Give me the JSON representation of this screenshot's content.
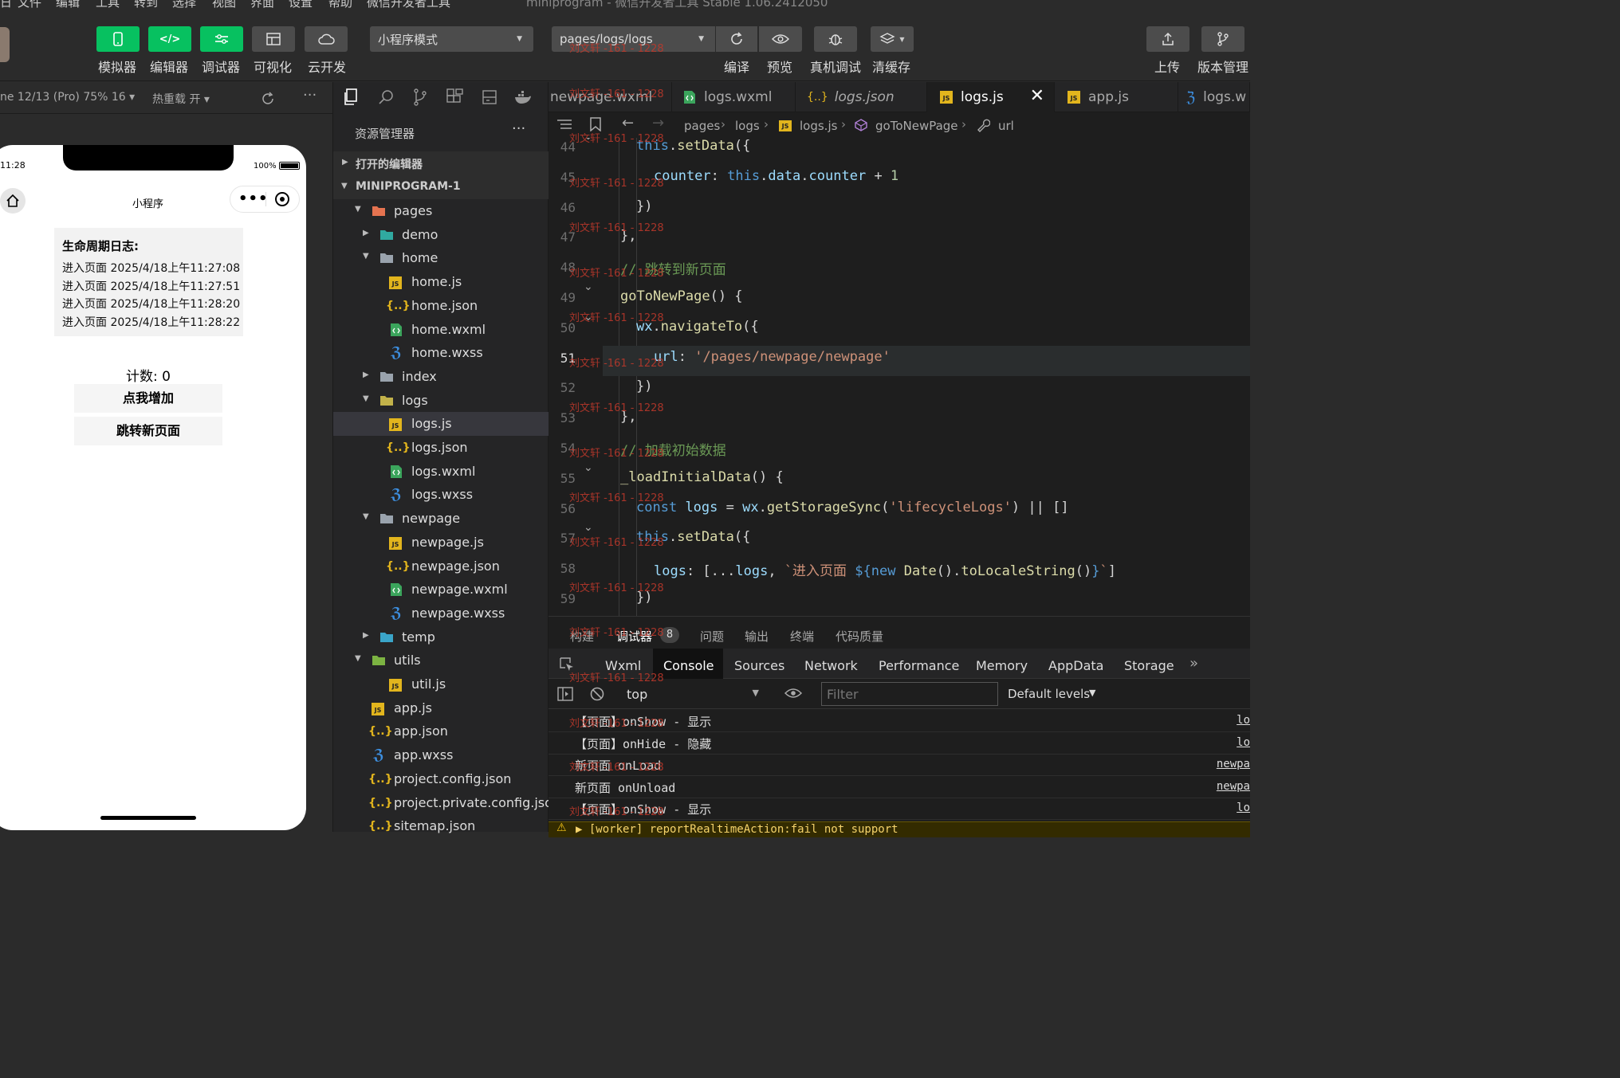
{
  "menubar": {
    "items": [
      "文件",
      "编辑",
      "工具",
      "转到",
      "选择",
      "视图",
      "界面",
      "设置",
      "帮助",
      "微信开发者工具"
    ],
    "title": "miniprogram - 微信开发者工具 Stable 1.06.2412050"
  },
  "toolbar": {
    "buttons": [
      {
        "label": "模拟器",
        "icon": "phone-icon"
      },
      {
        "label": "编辑器",
        "icon": "code-icon"
      },
      {
        "label": "调试器",
        "icon": "debug-icon"
      },
      {
        "label": "可视化",
        "icon": "layout-icon"
      },
      {
        "label": "云开发",
        "icon": "cloud-icon"
      }
    ],
    "mode": "小程序模式",
    "page_path": "pages/logs/logs",
    "actions": [
      "编译",
      "预览",
      "真机调试",
      "清缓存"
    ],
    "right_actions": [
      "上传",
      "版本管理"
    ]
  },
  "simbar": {
    "device": "ne 12/13 (Pro) 75% 16 ▾",
    "hot_reload": "热重载 开 ▾"
  },
  "phone": {
    "time": "11:28",
    "battery": "100%",
    "title": "小程序",
    "logs_title": "生命周期日志:",
    "logs": [
      "进入页面 2025/4/18上午11:27:08",
      "进入页面 2025/4/18上午11:27:51",
      "进入页面 2025/4/18上午11:28:20",
      "进入页面 2025/4/18上午11:28:22"
    ],
    "counter": "计数: 0",
    "btn_add": "点我增加",
    "btn_nav": "跳转新页面"
  },
  "explorer": {
    "title": "资源管理器",
    "open_editors": "打开的编辑器",
    "root": "MINIPROGRAM-1",
    "tree": [
      {
        "name": "pages",
        "type": "folder-pages",
        "depth": 1,
        "open": true
      },
      {
        "name": "demo",
        "type": "folder-demo",
        "depth": 2,
        "open": false
      },
      {
        "name": "home",
        "type": "folder",
        "depth": 2,
        "open": true
      },
      {
        "name": "home.js",
        "type": "js",
        "depth": 3
      },
      {
        "name": "home.json",
        "type": "json",
        "depth": 3
      },
      {
        "name": "home.wxml",
        "type": "wxml",
        "depth": 3
      },
      {
        "name": "home.wxss",
        "type": "wxss",
        "depth": 3
      },
      {
        "name": "index",
        "type": "folder",
        "depth": 2,
        "open": false
      },
      {
        "name": "logs",
        "type": "folder-logs",
        "depth": 2,
        "open": true
      },
      {
        "name": "logs.js",
        "type": "js",
        "depth": 3,
        "selected": true
      },
      {
        "name": "logs.json",
        "type": "json",
        "depth": 3
      },
      {
        "name": "logs.wxml",
        "type": "wxml",
        "depth": 3
      },
      {
        "name": "logs.wxss",
        "type": "wxss",
        "depth": 3
      },
      {
        "name": "newpage",
        "type": "folder",
        "depth": 2,
        "open": true
      },
      {
        "name": "newpage.js",
        "type": "js",
        "depth": 3
      },
      {
        "name": "newpage.json",
        "type": "json",
        "depth": 3
      },
      {
        "name": "newpage.wxml",
        "type": "wxml",
        "depth": 3
      },
      {
        "name": "newpage.wxss",
        "type": "wxss",
        "depth": 3
      },
      {
        "name": "temp",
        "type": "folder-temp",
        "depth": 2,
        "open": false
      },
      {
        "name": "utils",
        "type": "folder-utils",
        "depth": 1,
        "open": true
      },
      {
        "name": "util.js",
        "type": "js",
        "depth": 3
      },
      {
        "name": "app.js",
        "type": "js",
        "depth": 2
      },
      {
        "name": "app.json",
        "type": "json",
        "depth": 2
      },
      {
        "name": "app.wxss",
        "type": "wxss",
        "depth": 2
      },
      {
        "name": "project.config.json",
        "type": "json",
        "depth": 2
      },
      {
        "name": "project.private.config.json",
        "type": "json",
        "depth": 2
      },
      {
        "name": "sitemap.json",
        "type": "json",
        "depth": 2
      }
    ]
  },
  "tabs": [
    {
      "name": "newpage.wxml",
      "type": "none"
    },
    {
      "name": "logs.wxml",
      "type": "wxml"
    },
    {
      "name": "logs.json",
      "type": "json"
    },
    {
      "name": "logs.js",
      "type": "js",
      "active": true
    },
    {
      "name": "app.js",
      "type": "js"
    },
    {
      "name": "logs.w",
      "type": "wxss"
    }
  ],
  "breadcrumb": [
    "pages",
    "logs",
    "logs.js",
    "goToNewPage",
    "url"
  ],
  "code_lines": [
    {
      "n": "44",
      "html": "<span class='kw'>this</span>.<span class='fn'>setData</span>({"
    },
    {
      "n": "45",
      "html": "<span class='prop'>counter</span>: <span class='kw'>this</span>.<span class='prop'>data</span>.<span class='prop'>counter</span> + <span class='num'>1</span>"
    },
    {
      "n": "46",
      "html": "})"
    },
    {
      "n": "47",
      "html": "},"
    },
    {
      "n": "48",
      "html": "<span class='cm'>// 跳转到新页面</span>"
    },
    {
      "n": "49",
      "html": "<span class='fn'>goToNewPage</span>() {"
    },
    {
      "n": "50",
      "html": "<span class='prop'>wx</span>.<span class='fn'>navigateTo</span>({"
    },
    {
      "n": "51",
      "html": "<span class='prop'>url</span>: <span class='str'>'/pages/newpage/newpage'</span>"
    },
    {
      "n": "52",
      "html": "})"
    },
    {
      "n": "53",
      "html": "},"
    },
    {
      "n": "54",
      "html": "<span class='cm'>// 加载初始数据</span>"
    },
    {
      "n": "55",
      "html": "<span class='fn'>_loadInitialData</span>() {"
    },
    {
      "n": "56",
      "html": "<span class='kw'>const</span> <span class='prop'>logs</span> = <span class='prop'>wx</span>.<span class='fn'>getStorageSync</span>(<span class='str'>'lifecycleLogs'</span>) || []"
    },
    {
      "n": "57",
      "html": "<span class='kw'>this</span>.<span class='fn'>setData</span>({"
    },
    {
      "n": "58",
      "html": "<span class='prop'>logs</span>: [...<span class='prop'>logs</span>, <span class='str'>`进入页面 </span><span class='kw'>${new</span> <span class='fn'>Date</span>().<span class='fn'>toLocaleString</span>()<span class='kw'>}</span><span class='str'>`</span>]"
    },
    {
      "n": "59",
      "html": "})"
    }
  ],
  "watermark": "刘文轩 -161 - 1228",
  "panel": {
    "tabs": [
      "构建",
      "调试器",
      "问题",
      "输出",
      "终端",
      "代码质量"
    ],
    "debugger_badge": "8",
    "devtabs": [
      "Wxml",
      "Console",
      "Sources",
      "Network",
      "Performance",
      "Memory",
      "AppData",
      "Storage"
    ],
    "context": "top",
    "filter_placeholder": "Filter",
    "levels": "Default levels",
    "console_rows": [
      {
        "text": "【页面】onShow - 显示",
        "src": "lo"
      },
      {
        "text": "【页面】onHide - 隐藏",
        "src": "lo"
      },
      {
        "text": "新页面 onLoad",
        "src": "newpa"
      },
      {
        "text": "新页面 onUnload",
        "src": "newpa"
      },
      {
        "text": "【页面】onShow - 显示",
        "src": "lo"
      }
    ],
    "warning": "▶ [worker] reportRealtimeAction:fail not support"
  }
}
